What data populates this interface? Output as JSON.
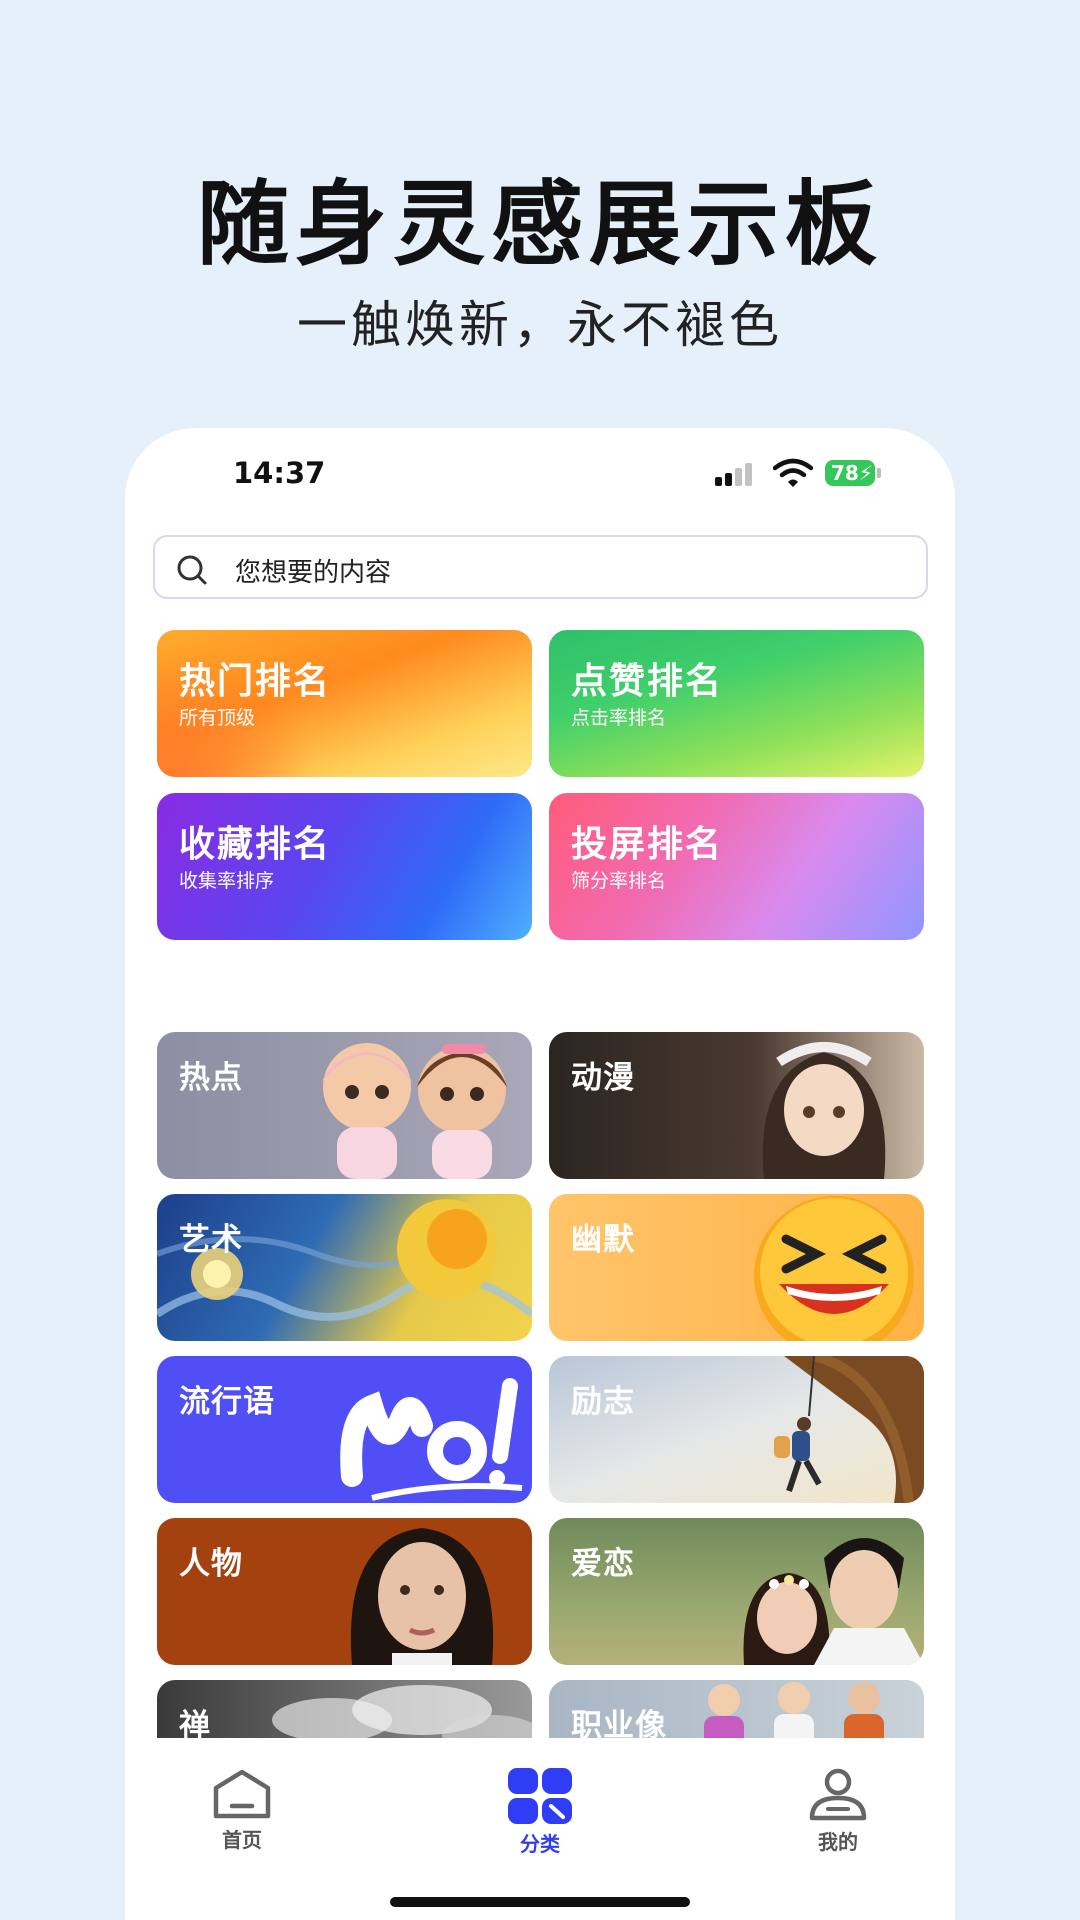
{
  "promo": {
    "title": "随身灵感展示板",
    "subtitle": "一触焕新，永不褪色"
  },
  "status_bar": {
    "time": "14:37",
    "battery": "78"
  },
  "search": {
    "placeholder": "您想要的内容",
    "icon": "search-icon"
  },
  "rankings": [
    {
      "title": "热门排名",
      "subtitle": "所有顶级",
      "color": "#ff8a1e"
    },
    {
      "title": "点赞排名",
      "subtitle": "点击率排名",
      "color": "#3fcf6b"
    },
    {
      "title": "收藏排名",
      "subtitle": "收集率排序",
      "color": "#5a46f0"
    },
    {
      "title": "投屏排名",
      "subtitle": "筛分率排名",
      "color": "#f26ab0"
    }
  ],
  "categories": [
    {
      "label": "热点"
    },
    {
      "label": "动漫"
    },
    {
      "label": "艺术"
    },
    {
      "label": "幽默"
    },
    {
      "label": "流行语"
    },
    {
      "label": "励志"
    },
    {
      "label": "人物"
    },
    {
      "label": "爱恋"
    },
    {
      "label": "禅"
    },
    {
      "label": "职业像"
    }
  ],
  "tabbar": {
    "items": [
      {
        "label": "首页",
        "icon": "home-icon"
      },
      {
        "label": "分类",
        "icon": "category-grid-icon",
        "active": true
      },
      {
        "label": "我的",
        "icon": "user-icon"
      }
    ],
    "accent": "#2f3ef5"
  }
}
